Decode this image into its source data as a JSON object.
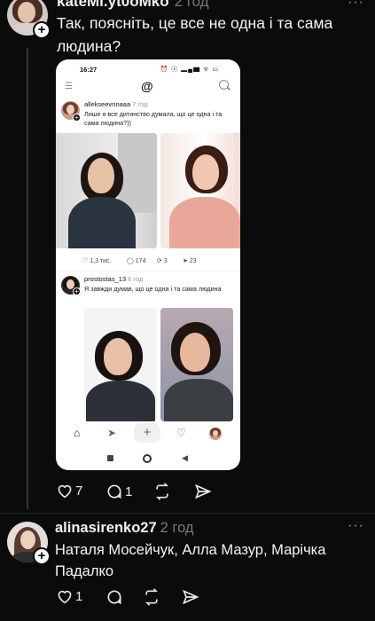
{
  "top_post": {
    "username": "kateMl.yt0oMko",
    "time": "2 год",
    "more": "···",
    "text": "Так, поясніть, це все не одна і та сама людина?",
    "actions": {
      "likes": "7",
      "comments": "1"
    }
  },
  "embedded": {
    "status_time": "16:27",
    "status_icons": "⏰ ⓢ ▂▄▆ ᯤ ▭",
    "app_logo": "@",
    "post1": {
      "username": "allekseevnnaaa",
      "time": "7 год",
      "text": "Лише я все дитинство думала, що це одна і та сама людина?))",
      "likes": "1,3 тис.",
      "comments": "174",
      "reposts": "3",
      "shares": "23"
    },
    "post2": {
      "username": "prostostas_13",
      "time": "6 год",
      "text": "Я завжди думав, що це одна і та сама людина"
    }
  },
  "comment": {
    "username": "alinasirenko27",
    "time": "2 год",
    "more": "···",
    "text": "Наталя Мосейчук, Алла Мазур, Марічка Падалко",
    "actions": {
      "likes": "1"
    }
  },
  "colors": {
    "background": "#0b0b0b",
    "text": "#f2f2f2",
    "muted": "#777777"
  }
}
